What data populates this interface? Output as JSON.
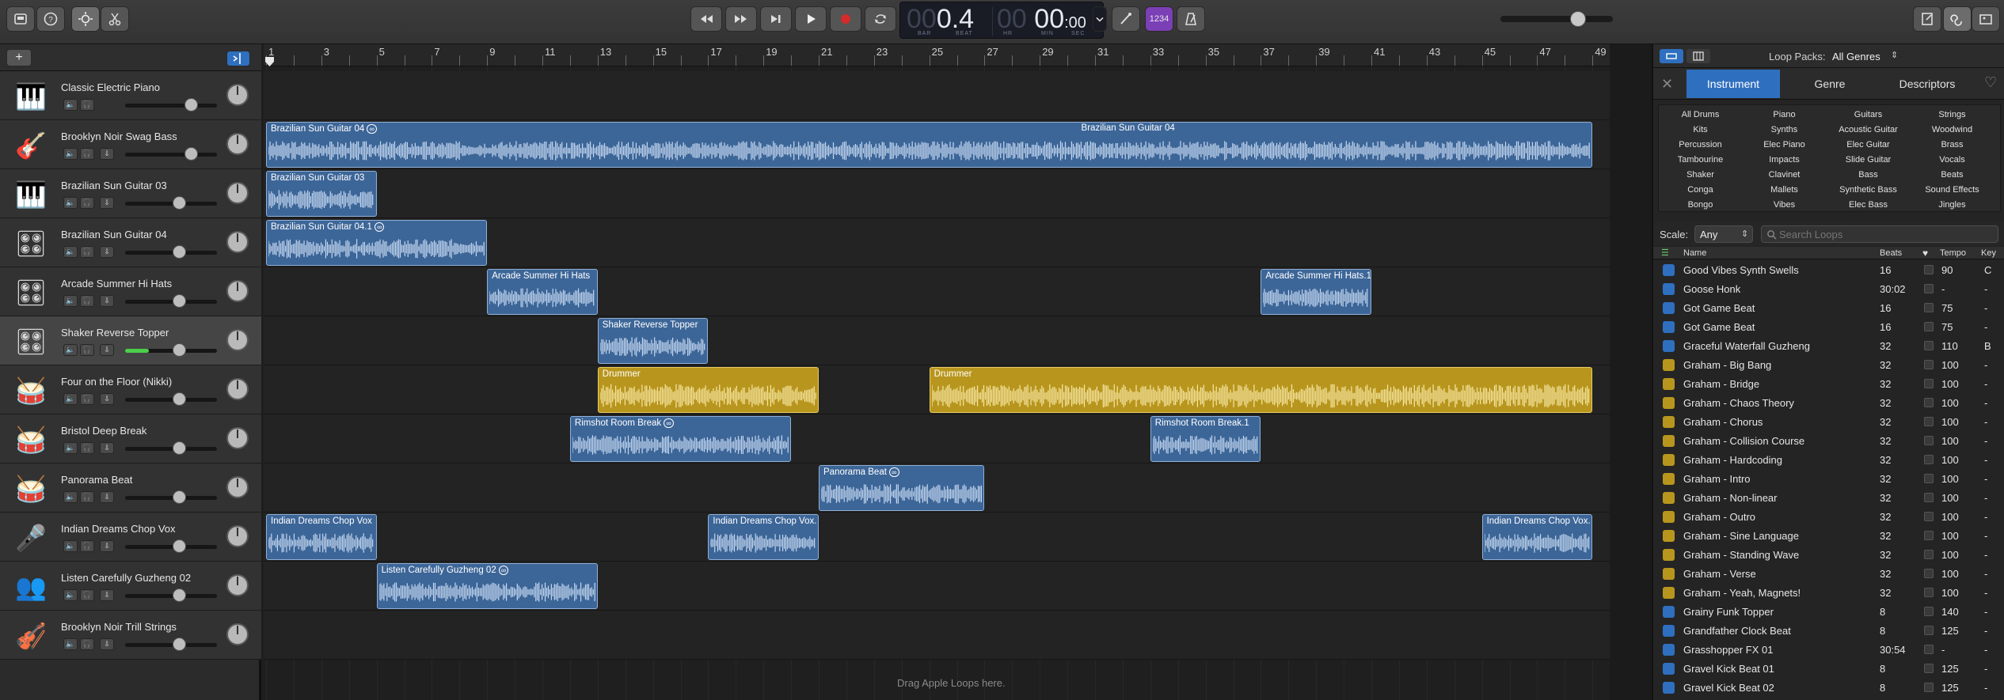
{
  "lcd": {
    "bar": "00",
    "beat_main": "0.4",
    "bar_label": "BAR",
    "beat_label": "BEAT",
    "time_dim": "00",
    "time_main": "00",
    "time_sec": ":00",
    "hr_label": "HR",
    "min_label": "MIN",
    "sec_label": "SEC"
  },
  "count_in": "1234",
  "tracks": [
    {
      "name": "Classic Electric Piano",
      "icon": "electric-piano-icon",
      "glyph": "🎹"
    },
    {
      "name": "Brooklyn Noir Swag Bass",
      "icon": "bass-guitar-icon",
      "glyph": "🎸"
    },
    {
      "name": "Brazilian Sun Guitar 03",
      "icon": "grand-piano-icon",
      "glyph": "🎹"
    },
    {
      "name": "Brazilian Sun Guitar 04",
      "icon": "drum-machine-icon",
      "glyph": "🎛"
    },
    {
      "name": "Arcade Summer Hi Hats",
      "icon": "drum-machine-icon",
      "glyph": "🎛"
    },
    {
      "name": "Shaker Reverse Topper",
      "icon": "drum-machine-icon",
      "glyph": "🎛"
    },
    {
      "name": "Four on the Floor (Nikki)",
      "icon": "drum-kit-icon",
      "glyph": "🥁"
    },
    {
      "name": "Bristol Deep Break",
      "icon": "drum-kit-icon",
      "glyph": "🥁"
    },
    {
      "name": "Panorama Beat",
      "icon": "drum-kit-icon",
      "glyph": "🥁"
    },
    {
      "name": "Indian Dreams Chop Vox",
      "icon": "microphone-icon",
      "glyph": "🎤"
    },
    {
      "name": "Listen Carefully Guzheng 02",
      "icon": "vocal-group-icon",
      "glyph": "👥"
    },
    {
      "name": "Brooklyn Noir Trill Strings",
      "icon": "violin-icon",
      "glyph": "🎻"
    }
  ],
  "selected_track": 5,
  "ruler": {
    "bars": [
      "1",
      "3",
      "5",
      "7",
      "9",
      "11",
      "13",
      "15",
      "17",
      "19",
      "21",
      "23",
      "25",
      "27",
      "29",
      "31",
      "33",
      "35",
      "37",
      "39",
      "41",
      "43",
      "45",
      "47",
      "49"
    ]
  },
  "regions": [
    {
      "lane": 1,
      "title": "Brazilian Sun Guitar 04",
      "loop": true,
      "start": 1,
      "end": 49,
      "color": "blue"
    },
    {
      "lane": 1,
      "title": "Brazilian Sun Guitar 04",
      "loop": true,
      "start": 30.5,
      "end": 30.6,
      "color": "label"
    },
    {
      "lane": 2,
      "title": "Brazilian Sun Guitar 03",
      "loop": false,
      "start": 1,
      "end": 5,
      "color": "blue"
    },
    {
      "lane": 3,
      "title": "Brazilian Sun Guitar 04.1",
      "loop": true,
      "start": 1,
      "end": 9,
      "color": "blue"
    },
    {
      "lane": 4,
      "title": "Arcade Summer Hi Hats",
      "loop": false,
      "start": 9,
      "end": 13,
      "color": "blue"
    },
    {
      "lane": 4,
      "title": "Arcade Summer Hi Hats.1",
      "loop": false,
      "start": 37,
      "end": 41,
      "color": "blue"
    },
    {
      "lane": 5,
      "title": "Shaker Reverse Topper",
      "loop": false,
      "start": 13,
      "end": 17,
      "color": "blue"
    },
    {
      "lane": 6,
      "title": "Drummer",
      "loop": false,
      "start": 13,
      "end": 21,
      "color": "gold"
    },
    {
      "lane": 6,
      "title": "Drummer",
      "loop": false,
      "start": 25,
      "end": 49,
      "color": "gold"
    },
    {
      "lane": 7,
      "title": "Rimshot Room Break",
      "loop": true,
      "start": 12,
      "end": 20,
      "color": "blue"
    },
    {
      "lane": 7,
      "title": "Rimshot Room Break.1",
      "loop": false,
      "start": 33,
      "end": 37,
      "color": "blue"
    },
    {
      "lane": 8,
      "title": "Panorama Beat",
      "loop": true,
      "start": 21,
      "end": 27,
      "color": "blue"
    },
    {
      "lane": 9,
      "title": "Indian Dreams Chop Vox",
      "loop": false,
      "start": 1,
      "end": 5,
      "color": "blue"
    },
    {
      "lane": 9,
      "title": "Indian Dreams Chop Vox.",
      "loop": false,
      "start": 17,
      "end": 21,
      "color": "blue"
    },
    {
      "lane": 9,
      "title": "Indian Dreams Chop Vox.",
      "loop": false,
      "start": 45,
      "end": 49,
      "color": "blue"
    },
    {
      "lane": 10,
      "title": "Listen Carefully Guzheng 02",
      "loop": true,
      "start": 5,
      "end": 13,
      "color": "blue"
    }
  ],
  "drop_hint": "Drag Apple Loops here.",
  "browser": {
    "loop_packs_label": "Loop Packs:",
    "loop_packs_value": "All Genres",
    "tabs": [
      "Instrument",
      "Genre",
      "Descriptors"
    ],
    "categories": [
      [
        "All Drums",
        "Piano",
        "Guitars",
        "Strings"
      ],
      [
        "Kits",
        "Synths",
        "Acoustic Guitar",
        "Woodwind"
      ],
      [
        "Percussion",
        "Elec Piano",
        "Elec Guitar",
        "Brass"
      ],
      [
        "Tambourine",
        "Impacts",
        "Slide Guitar",
        "Vocals"
      ],
      [
        "Shaker",
        "Clavinet",
        "Bass",
        "Beats"
      ],
      [
        "Conga",
        "Mallets",
        "Synthetic Bass",
        "Sound Effects"
      ],
      [
        "Bongo",
        "Vibes",
        "Elec Bass",
        "Jingles"
      ]
    ],
    "scale_label": "Scale:",
    "scale_value": "Any",
    "search_placeholder": "Search Loops",
    "columns": {
      "name": "Name",
      "beats": "Beats",
      "tempo": "Tempo",
      "key": "Key"
    },
    "loops": [
      {
        "name": "Good Vibes Synth Swells",
        "beats": "16",
        "tempo": "90",
        "key": "C",
        "type": "audio"
      },
      {
        "name": "Goose Honk",
        "beats": "30:02",
        "tempo": "-",
        "key": "-",
        "type": "audio"
      },
      {
        "name": "Got Game Beat",
        "beats": "16",
        "tempo": "75",
        "key": "-",
        "type": "audio"
      },
      {
        "name": "Got Game Beat",
        "beats": "16",
        "tempo": "75",
        "key": "-",
        "type": "audio"
      },
      {
        "name": "Graceful Waterfall Guzheng",
        "beats": "32",
        "tempo": "110",
        "key": "B",
        "type": "audio"
      },
      {
        "name": "Graham - Big Bang",
        "beats": "32",
        "tempo": "100",
        "key": "-",
        "type": "drummer"
      },
      {
        "name": "Graham - Bridge",
        "beats": "32",
        "tempo": "100",
        "key": "-",
        "type": "drummer"
      },
      {
        "name": "Graham - Chaos Theory",
        "beats": "32",
        "tempo": "100",
        "key": "-",
        "type": "drummer"
      },
      {
        "name": "Graham - Chorus",
        "beats": "32",
        "tempo": "100",
        "key": "-",
        "type": "drummer"
      },
      {
        "name": "Graham - Collision Course",
        "beats": "32",
        "tempo": "100",
        "key": "-",
        "type": "drummer"
      },
      {
        "name": "Graham - Hardcoding",
        "beats": "32",
        "tempo": "100",
        "key": "-",
        "type": "drummer"
      },
      {
        "name": "Graham - Intro",
        "beats": "32",
        "tempo": "100",
        "key": "-",
        "type": "drummer"
      },
      {
        "name": "Graham - Non-linear",
        "beats": "32",
        "tempo": "100",
        "key": "-",
        "type": "drummer"
      },
      {
        "name": "Graham - Outro",
        "beats": "32",
        "tempo": "100",
        "key": "-",
        "type": "drummer"
      },
      {
        "name": "Graham - Sine Language",
        "beats": "32",
        "tempo": "100",
        "key": "-",
        "type": "drummer"
      },
      {
        "name": "Graham - Standing Wave",
        "beats": "32",
        "tempo": "100",
        "key": "-",
        "type": "drummer"
      },
      {
        "name": "Graham - Verse",
        "beats": "32",
        "tempo": "100",
        "key": "-",
        "type": "drummer"
      },
      {
        "name": "Graham - Yeah, Magnets!",
        "beats": "32",
        "tempo": "100",
        "key": "-",
        "type": "drummer"
      },
      {
        "name": "Grainy Funk Topper",
        "beats": "8",
        "tempo": "140",
        "key": "-",
        "type": "audio"
      },
      {
        "name": "Grandfather Clock Beat",
        "beats": "8",
        "tempo": "125",
        "key": "-",
        "type": "audio"
      },
      {
        "name": "Grasshopper FX 01",
        "beats": "30:54",
        "tempo": "-",
        "key": "-",
        "type": "audio"
      },
      {
        "name": "Gravel Kick Beat 01",
        "beats": "8",
        "tempo": "125",
        "key": "-",
        "type": "audio"
      },
      {
        "name": "Gravel Kick Beat 02",
        "beats": "8",
        "tempo": "125",
        "key": "-",
        "type": "audio"
      }
    ]
  },
  "colors": {
    "audio_region": "#3d6698",
    "drummer_region": "#b8961e",
    "accent": "#2f6fbf",
    "record": "#d42a2a",
    "count_in": "#7b3fb6"
  }
}
